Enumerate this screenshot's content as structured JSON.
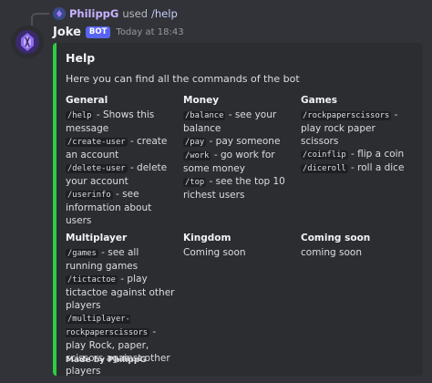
{
  "reply": {
    "user": "PhilippG",
    "verb": "used",
    "command": "/help"
  },
  "author": {
    "name": "Joke",
    "badge": "BOT",
    "timestamp": "Today at 18:43"
  },
  "embed": {
    "accent_color": "#2ecc40",
    "title": "Help",
    "description": "Here you can find all the commands of the bot",
    "footer": "Made by PhilippG",
    "fields": [
      {
        "name": "General",
        "entries": [
          {
            "cmd": "/help",
            "text": " - Shows this message"
          },
          {
            "cmd": "/create-user",
            "text": " - create an account"
          },
          {
            "cmd": "/delete-user",
            "text": " - delete your account"
          },
          {
            "cmd": "/userinfo",
            "text": " - see information about users"
          }
        ]
      },
      {
        "name": "Money",
        "entries": [
          {
            "cmd": "/balance",
            "text": " - see your balance"
          },
          {
            "cmd": "/pay",
            "text": " - pay someone"
          },
          {
            "cmd": "/work",
            "text": " - go work for some money"
          },
          {
            "cmd": "/top",
            "text": " - see the top 10 richest users"
          }
        ]
      },
      {
        "name": "Games",
        "entries": [
          {
            "cmd": "/rockpaperscissors",
            "text": " - play rock paper scissors"
          },
          {
            "cmd": "/coinflip",
            "text": " - flip a coin"
          },
          {
            "cmd": "/diceroll",
            "text": " - roll a dice"
          }
        ]
      },
      {
        "name": "Multiplayer",
        "entries": [
          {
            "cmd": "/games",
            "text": " - see all running games"
          },
          {
            "cmd": "/tictactoe",
            "text": " - play tictactoe against other players"
          },
          {
            "cmd": "/multiplayer-rockpaperscissors",
            "text": " - play Rock, paper, scissors against other players"
          }
        ]
      },
      {
        "name": "Kingdom",
        "entries": [
          {
            "cmd": "",
            "text": "Coming soon"
          }
        ]
      },
      {
        "name": "Coming soon",
        "entries": [
          {
            "cmd": "",
            "text": "coming soon"
          }
        ]
      }
    ]
  }
}
